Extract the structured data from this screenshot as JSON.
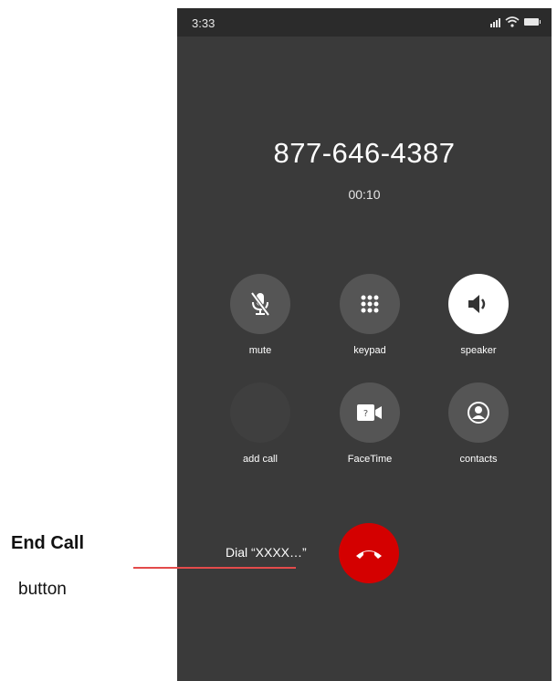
{
  "status_bar": {
    "time": "3:33"
  },
  "call": {
    "number": "877-646-4387",
    "timer": "00:10"
  },
  "controls": [
    {
      "label": "mute",
      "icon": "mic-off-icon"
    },
    {
      "label": "keypad",
      "icon": "keypad-icon"
    },
    {
      "label": "speaker",
      "icon": "speaker-icon",
      "active": true
    },
    {
      "label": "add call",
      "icon": "add-call-icon"
    },
    {
      "label": "FaceTime",
      "icon": "facetime-icon"
    },
    {
      "label": "contacts",
      "icon": "contacts-icon"
    }
  ],
  "dial_label": "Dial “XXXX…”",
  "end_call": {
    "icon": "end-call-icon",
    "color": "#d40000"
  },
  "annotation": {
    "title": "End Call",
    "subtitle": "button",
    "line_color": "#e34b4b"
  },
  "colors": {
    "background": "#3a3a3a",
    "status_bar": "#2b2b2b",
    "button": "#555555"
  }
}
